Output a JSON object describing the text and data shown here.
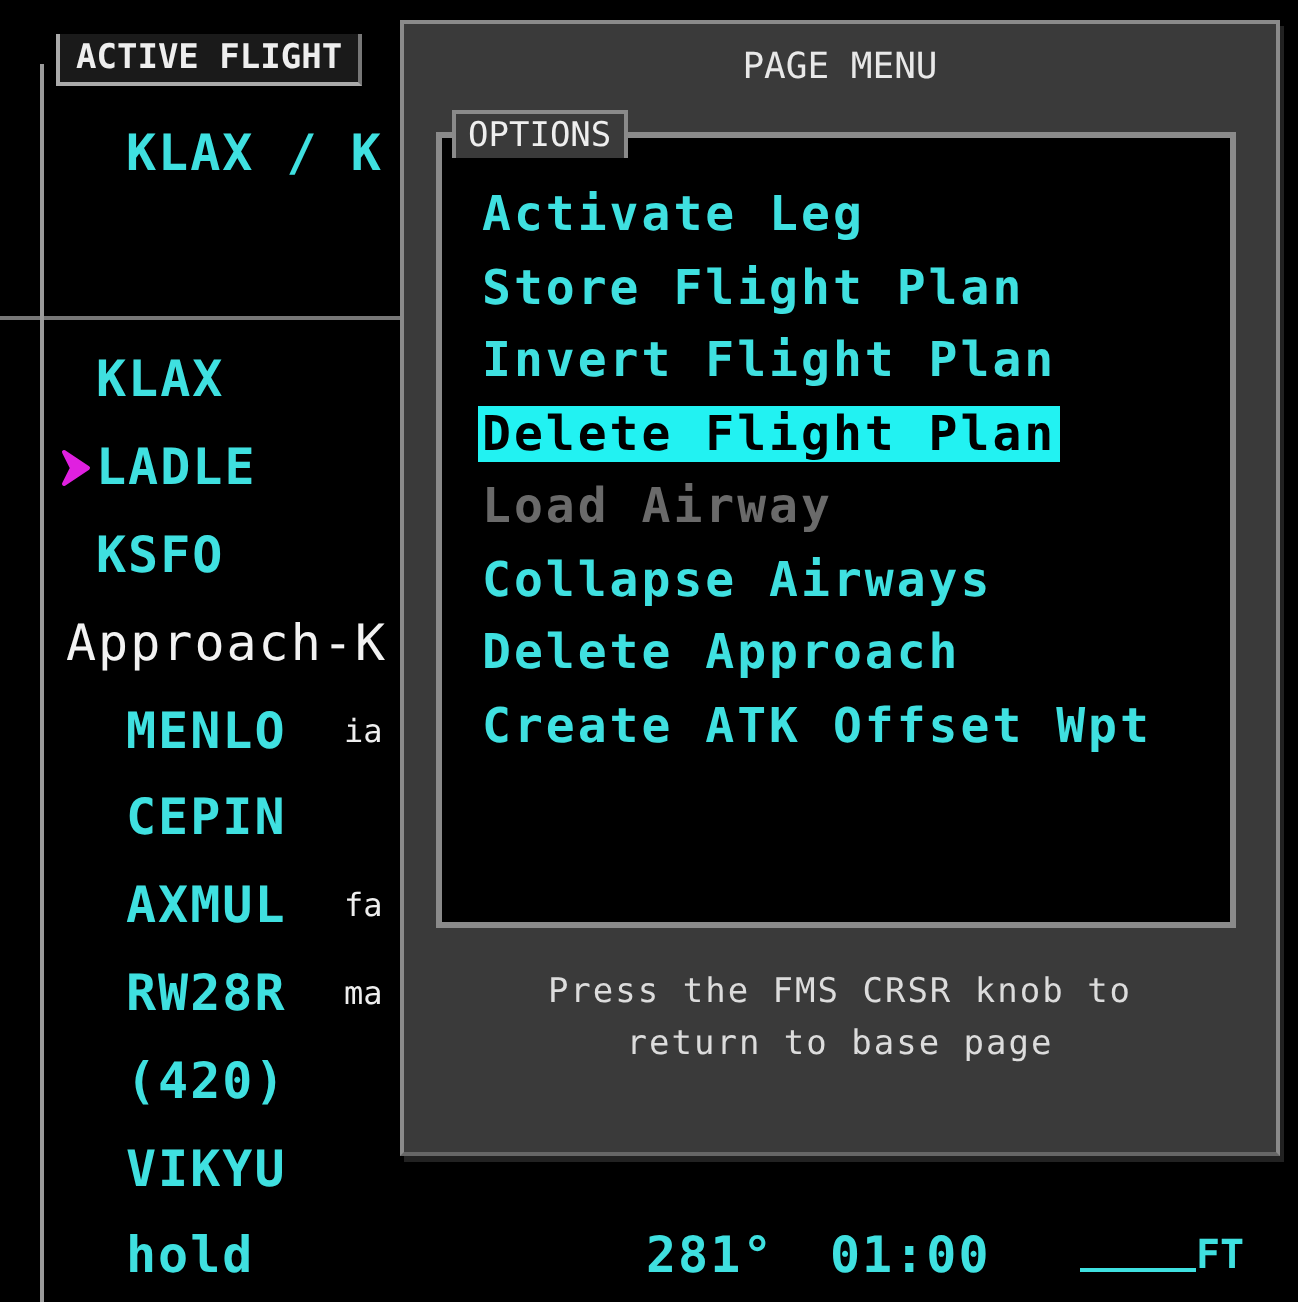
{
  "panel": {
    "title": "ACTIVE FLIGHT",
    "route": "KLAX / K"
  },
  "legs": [
    {
      "kind": "waypoint",
      "name": "KLAX",
      "active": false
    },
    {
      "kind": "waypoint",
      "name": "LADLE",
      "active": true
    },
    {
      "kind": "waypoint",
      "name": "KSFO",
      "active": false
    },
    {
      "kind": "procedure",
      "name": "Approach-K",
      "children": [
        {
          "name": "MENLO",
          "note": "ia"
        },
        {
          "name": "CEPIN"
        },
        {
          "name": "AXMUL",
          "note": "fa"
        },
        {
          "name": "RW28R",
          "note": "ma"
        },
        {
          "name": "(420)"
        },
        {
          "name": "VIKYU"
        },
        {
          "name": "hold",
          "dtk": "281°",
          "dist": "01:00",
          "alt": "FT",
          "alt_empty": true
        }
      ]
    }
  ],
  "page_menu": {
    "title": "PAGE MENU",
    "group": "OPTIONS",
    "options": [
      {
        "label": "Activate Leg",
        "selected": false,
        "disabled": false
      },
      {
        "label": "Store Flight Plan",
        "selected": false,
        "disabled": false
      },
      {
        "label": "Invert Flight Plan",
        "selected": false,
        "disabled": false
      },
      {
        "label": "Delete Flight Plan",
        "selected": true,
        "disabled": false
      },
      {
        "label": "Load Airway",
        "selected": false,
        "disabled": true
      },
      {
        "label": "Collapse Airways",
        "selected": false,
        "disabled": false
      },
      {
        "label": "Delete Approach",
        "selected": false,
        "disabled": false
      },
      {
        "label": "Create ATK Offset Wpt",
        "selected": false,
        "disabled": false
      }
    ],
    "footer": [
      "Press the FMS CRSR knob to",
      "return to base page"
    ]
  }
}
